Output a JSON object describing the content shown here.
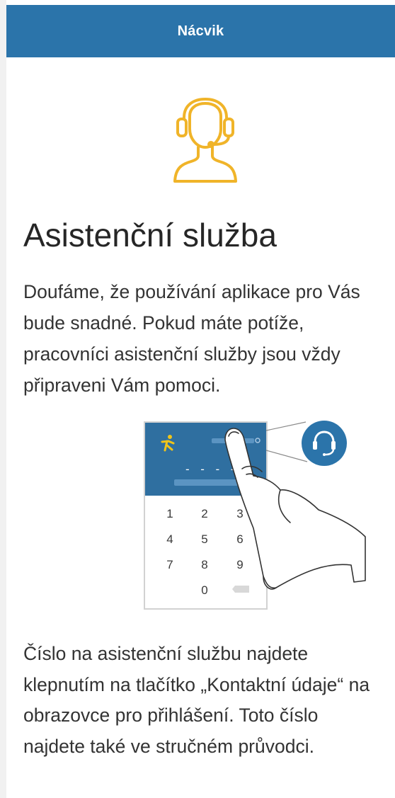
{
  "header": {
    "title": "Nácvik"
  },
  "main": {
    "icon": "headset-support-icon",
    "title": "Asistenční služba",
    "intro": "Doufáme, že používání aplikace pro Vás bude snadné. Pokud máte potíže, pracovníci asistenční služby jsou vždy připraveni Vám pomoci.",
    "outro": "Číslo na asistenční službu najdete klepnutím na tlačítko „Kontaktní údaje“ na obrazovce pro přihlášení. Toto číslo najdete také ve stručném průvodci."
  },
  "illustration": {
    "pin_placeholder": "- - - -",
    "keypad": [
      "1",
      "2",
      "3",
      "4",
      "5",
      "6",
      "7",
      "8",
      "9",
      "0"
    ],
    "icons": [
      "runner-logo-icon",
      "headset-icon",
      "backspace-icon",
      "hand-pointer-icon"
    ]
  },
  "colors": {
    "header": "#2b74aa",
    "accent": "#f0b429",
    "text": "#333333",
    "illustration_blue": "#2f6fa0"
  }
}
